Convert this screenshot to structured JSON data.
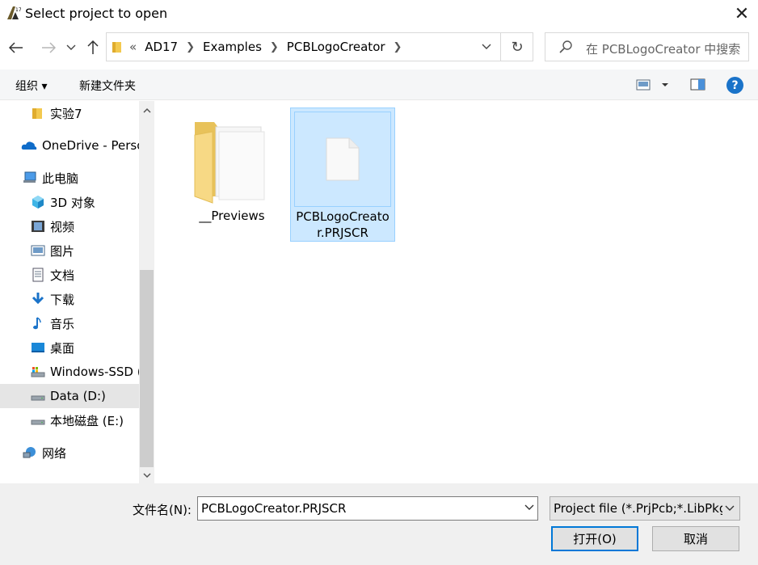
{
  "window": {
    "title": "Select project to open",
    "app_icon": "altium-logo-icon"
  },
  "nav": {
    "breadcrumb_overflow": "«",
    "breadcrumbs": [
      "AD17",
      "Examples",
      "PCBLogoCreator"
    ],
    "search_placeholder": "在 PCBLogoCreator 中搜索"
  },
  "toolbar": {
    "organize_label": "组织 ▾",
    "new_folder_label": "新建文件夹",
    "help_label": "?"
  },
  "sidebar": {
    "items": [
      {
        "label": "实验7",
        "icon": "folder-icon"
      },
      {
        "label": "OneDrive - Personal",
        "icon": "onedrive-cloud-icon"
      },
      {
        "label": "此电脑",
        "icon": "computer-icon"
      },
      {
        "label": "3D 对象",
        "icon": "3d-objects-icon"
      },
      {
        "label": "视频",
        "icon": "video-icon"
      },
      {
        "label": "图片",
        "icon": "pictures-icon"
      },
      {
        "label": "文档",
        "icon": "documents-icon"
      },
      {
        "label": "下载",
        "icon": "download-icon"
      },
      {
        "label": "音乐",
        "icon": "music-icon"
      },
      {
        "label": "桌面",
        "icon": "desktop-icon"
      },
      {
        "label": "Windows-SSD (C:)",
        "icon": "drive-icon"
      },
      {
        "label": "Data (D:)",
        "icon": "drive-icon",
        "selected": true
      },
      {
        "label": "本地磁盘 (E:)",
        "icon": "drive-icon"
      },
      {
        "label": "网络",
        "icon": "network-icon"
      }
    ]
  },
  "files": [
    {
      "name": "__Previews",
      "type": "folder"
    },
    {
      "name": "PCBLogoCreato\nr.PRJSCR",
      "line1": "PCBLogoCreato",
      "line2": "r.PRJSCR",
      "type": "file",
      "selected": true
    }
  ],
  "bottom": {
    "filename_label": "文件名(N):",
    "filename_value": "PCBLogoCreator.PRJSCR",
    "filter_value": "Project file (*.PrjPcb;*.LibPkg",
    "open_label": "打开(O)",
    "cancel_label": "取消"
  },
  "colors": {
    "accent": "#0078d7",
    "selection": "#cce8ff",
    "sidebar_selected": "#e5e5e5"
  }
}
